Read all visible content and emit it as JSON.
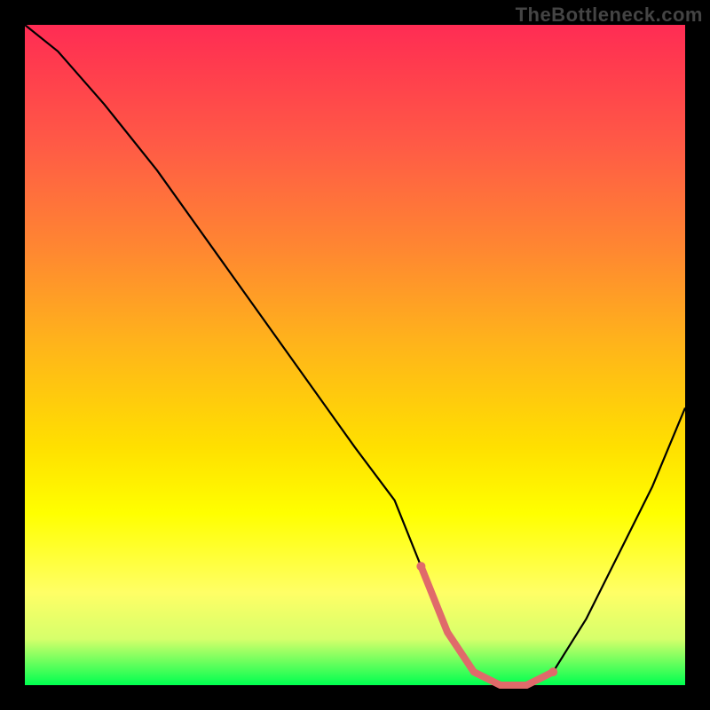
{
  "watermark": "TheBottleneck.com",
  "colors": {
    "page_bg": "#000000",
    "gradient_top": "#ff2c54",
    "gradient_bottom": "#00ff50",
    "curve": "#000000",
    "highlight": "#e06a6a"
  },
  "chart_data": {
    "type": "line",
    "title": "",
    "xlabel": "",
    "ylabel": "",
    "xlim": [
      0,
      100
    ],
    "ylim": [
      0,
      100
    ],
    "x": [
      0,
      5,
      12,
      20,
      30,
      40,
      50,
      56,
      60,
      64,
      68,
      72,
      76,
      80,
      85,
      90,
      95,
      100
    ],
    "values": [
      100,
      96,
      88,
      78,
      64,
      50,
      36,
      28,
      18,
      8,
      2,
      0,
      0,
      2,
      10,
      20,
      30,
      42
    ],
    "highlight_range_x": [
      60,
      80
    ]
  }
}
